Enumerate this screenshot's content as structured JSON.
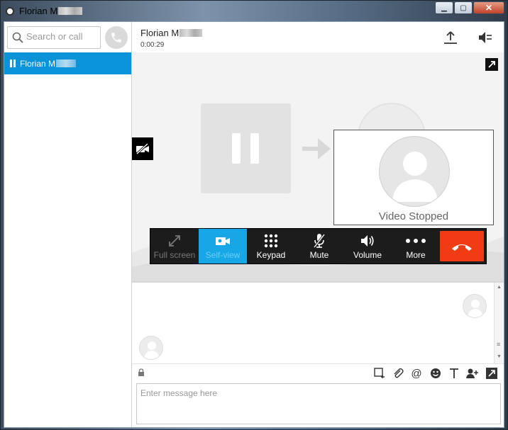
{
  "window": {
    "title": "Florian M",
    "min_icon": "minimize-icon",
    "max_icon": "maximize-icon",
    "close_icon": "close-icon"
  },
  "sidebar": {
    "search_placeholder": "Search or call",
    "contacts": [
      {
        "name": "Florian M",
        "status_icon": "pause-icon",
        "selected": true
      }
    ]
  },
  "call": {
    "contact_name": "Florian M",
    "duration": "0:00:29",
    "self_view_status": "Video Stopped"
  },
  "toolbar": {
    "fullscreen": "Full screen",
    "selfview": "Self-view",
    "keypad": "Keypad",
    "mute": "Mute",
    "volume": "Volume",
    "more": "More"
  },
  "compose": {
    "placeholder": "Enter message here"
  },
  "colors": {
    "accent": "#0a93d6",
    "active_tool": "#17a7e6",
    "hangup": "#f03b14",
    "toolbar_bg": "#1c1c1c"
  }
}
